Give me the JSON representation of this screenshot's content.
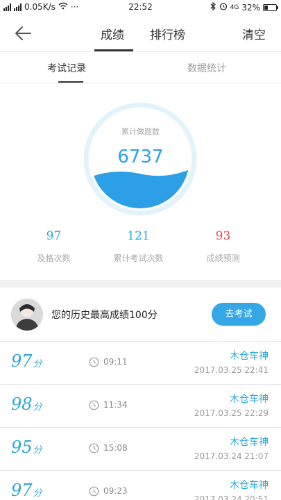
{
  "status_bar": {
    "speed": "0.05K/s",
    "time": "22:52",
    "battery": "32%",
    "net_label": "4G"
  },
  "header": {
    "tabs": [
      "成绩",
      "排行榜"
    ],
    "active_tab": "成绩",
    "clear_label": "清空"
  },
  "sub_tabs": [
    "考试记录",
    "数据统计"
  ],
  "gauge": {
    "label": "累计做题数",
    "value": "6737",
    "fill_level": 0.35,
    "accent": "#2c9fe6"
  },
  "stats": [
    {
      "value": "97",
      "label": "及格次数",
      "color": "#2ba6d8"
    },
    {
      "value": "121",
      "label": "累计考试次数",
      "color": "#2ba6d8"
    },
    {
      "value": "93",
      "label": "成绩预测",
      "color": "#e24b4b"
    }
  ],
  "profile": {
    "best_text": "您的历史最高成绩100分",
    "exam_button": "去考试"
  },
  "records": [
    {
      "score": "97",
      "unit": "分",
      "duration": "09:11",
      "name": "木仓车神",
      "date": "2017.03.25  22:41"
    },
    {
      "score": "98",
      "unit": "分",
      "duration": "11:34",
      "name": "木仓车神",
      "date": "2017.03.25  22:29"
    },
    {
      "score": "95",
      "unit": "分",
      "duration": "15:08",
      "name": "木仓车神",
      "date": "2017.03.24  21:07"
    },
    {
      "score": "97",
      "unit": "分",
      "duration": "09:23",
      "name": "木仓车神",
      "date": "2017.03.24  20:51"
    }
  ]
}
